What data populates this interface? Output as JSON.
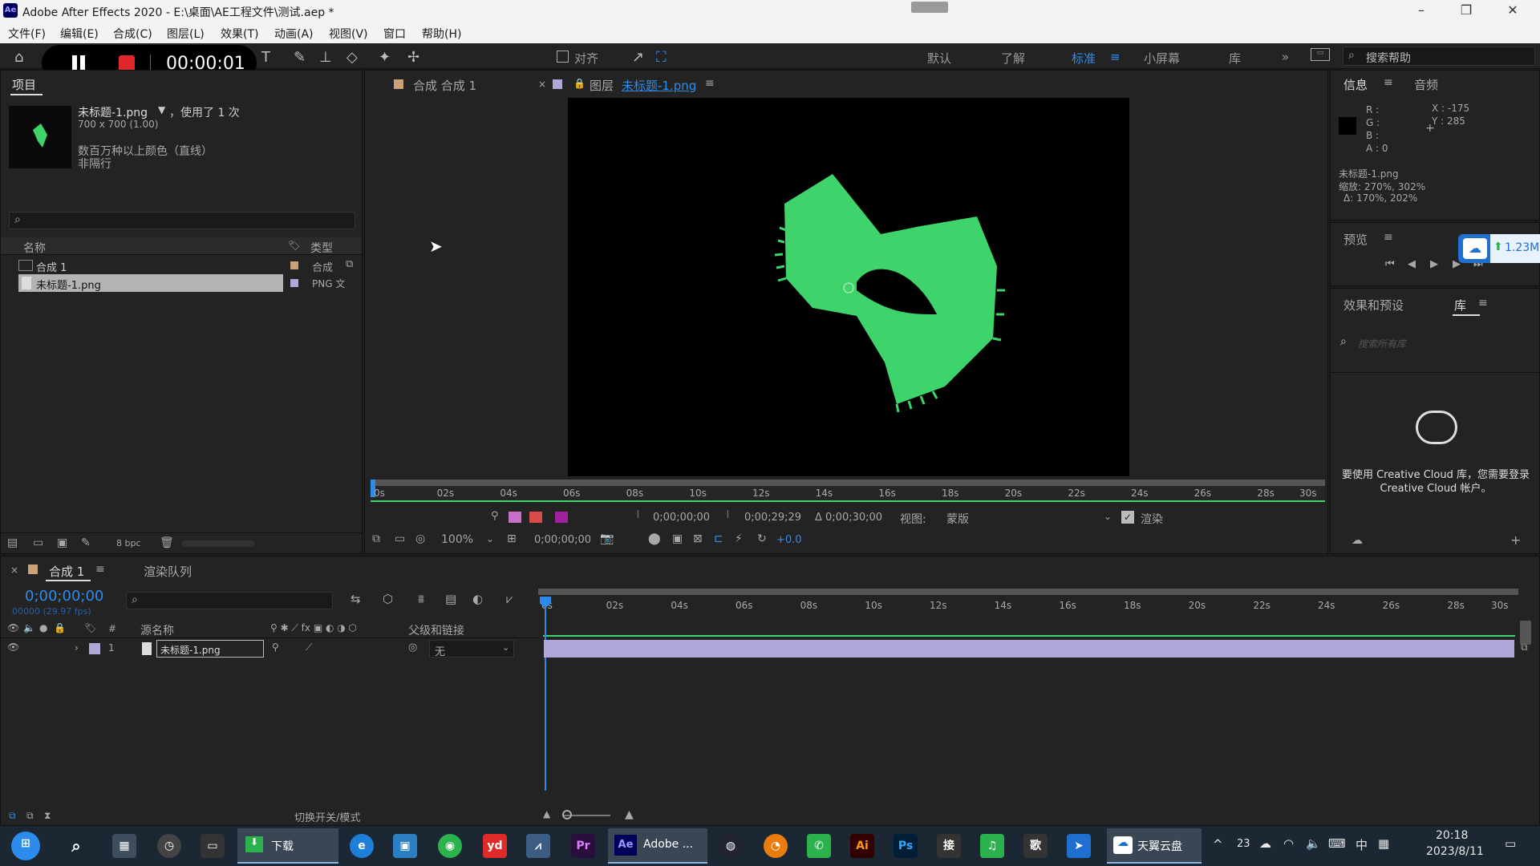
{
  "window": {
    "title": "Adobe After Effects 2020 - E:\\桌面\\AE工程文件\\测试.aep *",
    "app_icon": "Ae"
  },
  "menu": [
    "文件(F)",
    "编辑(E)",
    "合成(C)",
    "图层(L)",
    "效果(T)",
    "动画(A)",
    "视图(V)",
    "窗口",
    "帮助(H)"
  ],
  "recorder": {
    "time": "00:00:01"
  },
  "toolbar": {
    "align_label": "对齐",
    "workspaces": [
      "默认",
      "了解",
      "标准",
      "小屏幕",
      "库"
    ],
    "active_workspace": "标准",
    "search_help": "搜索帮助"
  },
  "project": {
    "tab": "项目",
    "selected_name": "未标题-1.png",
    "used_text": "，使用了 1 次",
    "dimensions": "700 x 700 (1.00)",
    "colors": "数百万种以上颜色（直线）",
    "interlace": "非隔行",
    "col_name": "名称",
    "col_type": "类型",
    "items": [
      {
        "name": "合成 1",
        "type": "合成"
      },
      {
        "name": "未标题-1.png",
        "type": "PNG 文"
      }
    ],
    "bpc": "8 bpc"
  },
  "viewer": {
    "tab_comp": "合成 合成 1",
    "tab_layer_prefix": "图层",
    "tab_layer_name": "未标题-1.png",
    "ruler": [
      "0s",
      "02s",
      "04s",
      "06s",
      "08s",
      "10s",
      "12s",
      "14s",
      "16s",
      "18s",
      "20s",
      "22s",
      "24s",
      "26s",
      "28s",
      "30s"
    ],
    "in_point": "0;00;00;00",
    "out_point": "0;00;29;29",
    "duration": "Δ 0;00;30;00",
    "view_label": "视图:",
    "view_value": "蒙版",
    "render_label": "渲染",
    "zoom": "100%",
    "current_time": "0;00;00;00",
    "exposure": "+0.0"
  },
  "info": {
    "tab_info": "信息",
    "tab_audio": "音频",
    "r": "R :",
    "g": "G :",
    "b": "B :",
    "a": "A : 0",
    "x": "X : -175",
    "y": "Y : 285",
    "file": "未标题-1.png",
    "scale": "缩放: 270%, 302%",
    "delta": "Δ: 170%, 202%"
  },
  "preview": {
    "title": "预览",
    "cloud_speed": "1.23M"
  },
  "effects": {
    "tab_effects": "效果和预设",
    "tab_library": "库",
    "search_placeholder": "搜索所有库",
    "cc_message": "要使用 Creative Cloud 库，您需要登录 Creative Cloud 帐户。"
  },
  "timeline": {
    "tab_comp": "合成 1",
    "tab_render": "渲染队列",
    "timecode": "0;00;00;00",
    "frame_info": "00000 (29.97 fps)",
    "col_source": "源名称",
    "col_parent": "父级和链接",
    "layer_num": "1",
    "layer_name": "未标题-1.png",
    "parent_value": "无",
    "ruler": [
      "0s",
      "02s",
      "04s",
      "06s",
      "08s",
      "10s",
      "12s",
      "14s",
      "16s",
      "18s",
      "20s",
      "22s",
      "24s",
      "26s",
      "28s",
      "30s"
    ],
    "toggle_label": "切换开关/模式"
  },
  "taskbar": {
    "download_label": "下载",
    "ae_label": "Adobe ...",
    "cloud_label": "天翼云盘",
    "tray_num": "23",
    "ime": "中",
    "time": "20:18",
    "date": "2023/8/11",
    "apps": [
      "yd",
      "Pr",
      "Ae",
      "Ai",
      "Ps",
      "接",
      "歌"
    ]
  },
  "colors": {
    "accent": "#2d8ceb",
    "shape": "#3fd46b",
    "layer_bar": "#b0a7d8",
    "record": "#e0272b"
  }
}
